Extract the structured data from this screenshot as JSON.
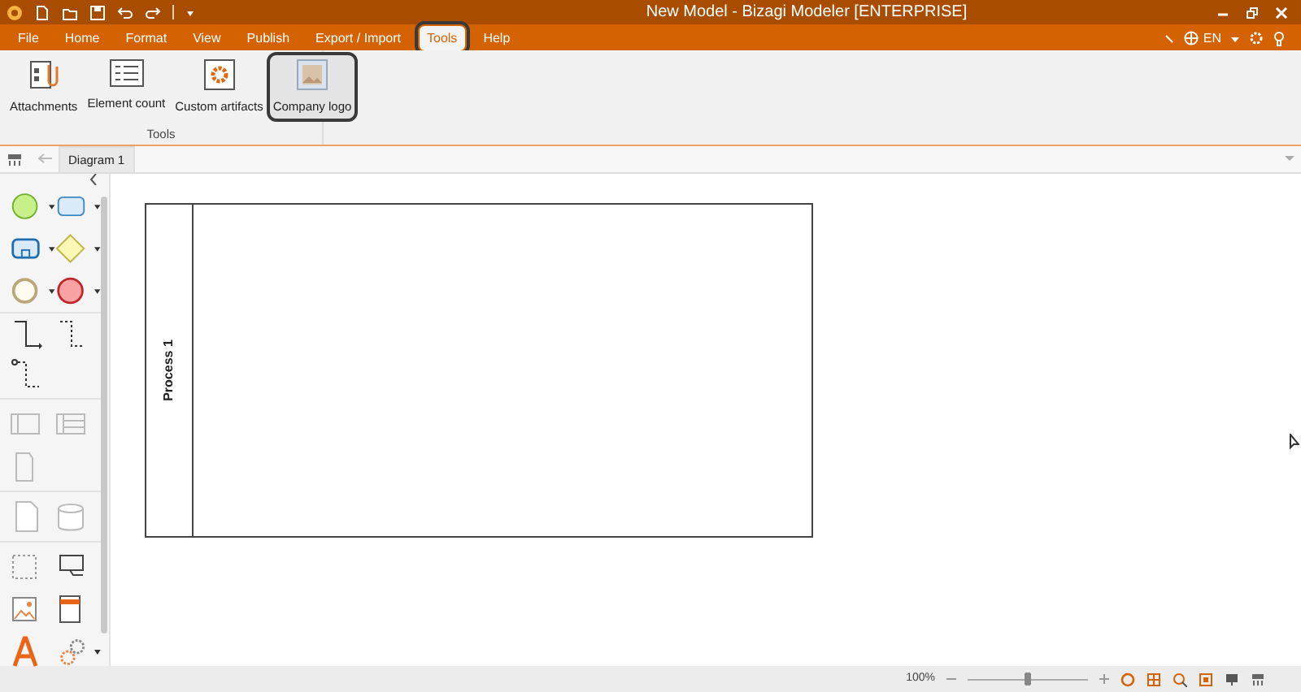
{
  "window": {
    "title": "New Model - Bizagi Modeler [ENTERPRISE]"
  },
  "menu": [
    {
      "label": "File",
      "selected": false,
      "highlighted": false
    },
    {
      "label": "Home",
      "selected": false,
      "highlighted": false
    },
    {
      "label": "Format",
      "selected": false,
      "highlighted": false
    },
    {
      "label": "View",
      "selected": false,
      "highlighted": false
    },
    {
      "label": "Publish",
      "selected": false,
      "highlighted": false
    },
    {
      "label": "Export / Import",
      "selected": false,
      "highlighted": false
    },
    {
      "label": "Tools",
      "selected": true,
      "highlighted": true
    },
    {
      "label": "Help",
      "selected": false,
      "highlighted": false
    }
  ],
  "language": "EN",
  "ribbon": {
    "buttons": [
      {
        "kind": "attachments",
        "label": "Attachments",
        "highlighted": false
      },
      {
        "kind": "count",
        "label": "Element count",
        "highlighted": false
      },
      {
        "kind": "artifacts",
        "label": "Custom artifacts",
        "highlighted": false
      },
      {
        "kind": "logo",
        "label": "Company logo",
        "highlighted": true
      }
    ],
    "group": "Tools"
  },
  "tabs": [
    {
      "label": "Diagram 1",
      "selected": true
    }
  ],
  "pool": {
    "label": "Process 1"
  },
  "status_bar": {
    "zoom": "100%",
    "level": 0.5
  }
}
